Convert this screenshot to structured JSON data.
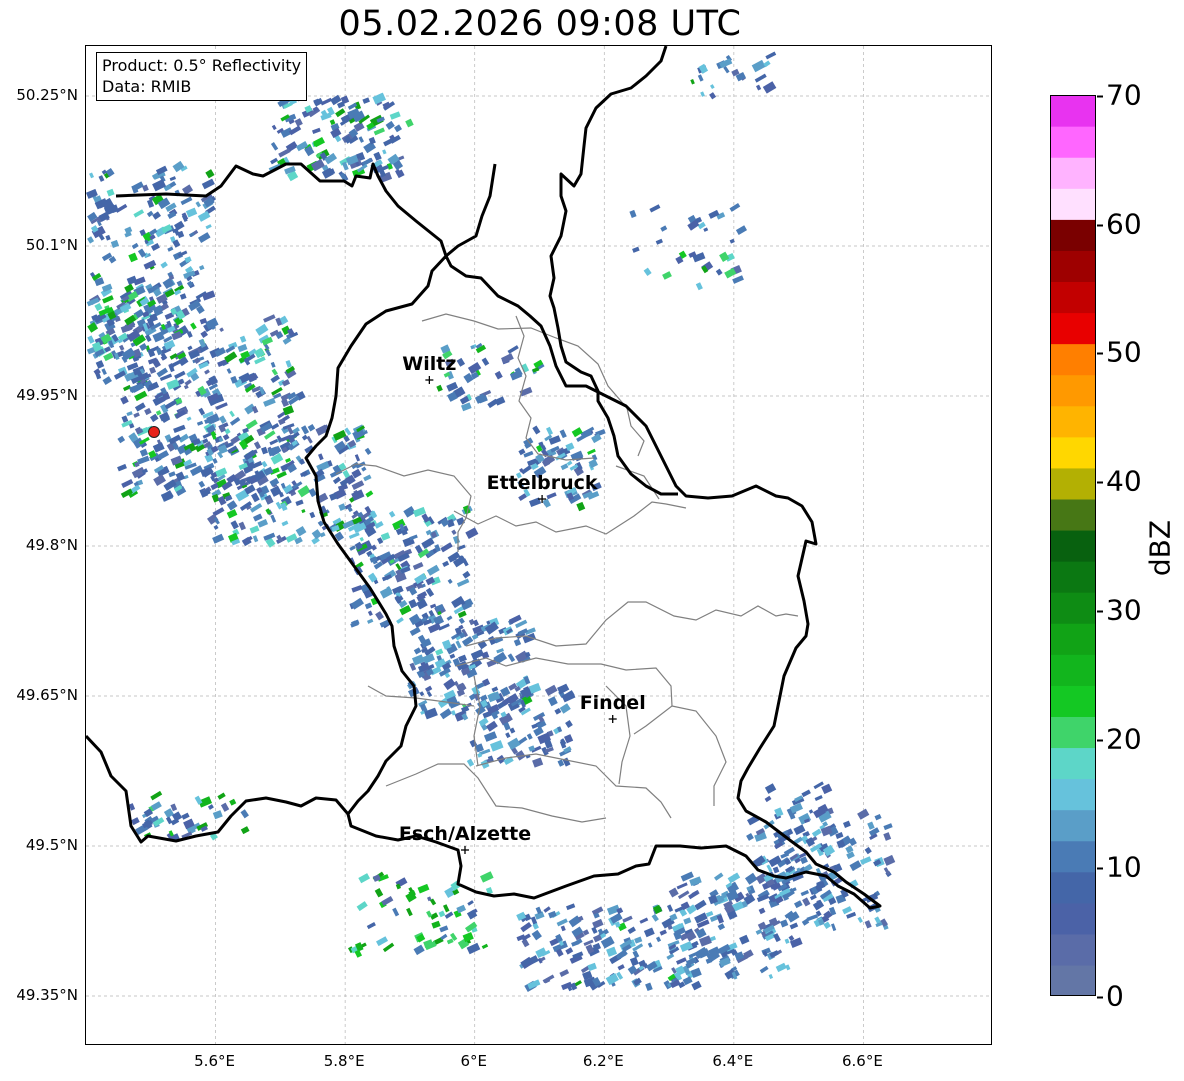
{
  "title": "05.02.2026 09:08 UTC",
  "info_box": {
    "product": "Product: 0.5° Reflectivity",
    "data": "Data: RMIB"
  },
  "map": {
    "lon_range": [
      5.4,
      6.8
    ],
    "lat_range": [
      49.3,
      50.3
    ],
    "lat_ticks": [
      {
        "value": 50.25,
        "label": "50.25°N"
      },
      {
        "value": 50.1,
        "label": "50.1°N"
      },
      {
        "value": 49.95,
        "label": "49.95°N"
      },
      {
        "value": 49.8,
        "label": "49.8°N"
      },
      {
        "value": 49.65,
        "label": "49.65°N"
      },
      {
        "value": 49.5,
        "label": "49.5°N"
      },
      {
        "value": 49.35,
        "label": "49.35°N"
      }
    ],
    "lon_ticks": [
      {
        "value": 5.6,
        "label": "5.6°E"
      },
      {
        "value": 5.8,
        "label": "5.8°E"
      },
      {
        "value": 6.0,
        "label": "6°E"
      },
      {
        "value": 6.2,
        "label": "6.2°E"
      },
      {
        "value": 6.4,
        "label": "6.4°E"
      },
      {
        "value": 6.6,
        "label": "6.6°E"
      }
    ],
    "grid": true,
    "cities": [
      {
        "name": "Wiltz",
        "lon": 5.93,
        "lat": 49.966
      },
      {
        "name": "Ettelbruck",
        "lon": 6.104,
        "lat": 49.847
      },
      {
        "name": "Findel",
        "lon": 6.213,
        "lat": 49.627
      },
      {
        "name": "Esch/Alzette",
        "lon": 5.985,
        "lat": 49.496
      }
    ],
    "radar_site": {
      "lon": 5.505,
      "lat": 49.914,
      "color": "#e8231a"
    },
    "border_color": "#000000",
    "canton_color": "#808080"
  },
  "colorbar": {
    "label": "dBZ",
    "min": 0,
    "max": 70,
    "ticks": [
      "0",
      "10",
      "20",
      "30",
      "40",
      "50",
      "60",
      "70"
    ],
    "colors": [
      "#6376a6",
      "#5a6ca8",
      "#4b62a7",
      "#4466a8",
      "#4a7bb5",
      "#5a9ec8",
      "#66c2dc",
      "#5dd6c8",
      "#3fd46a",
      "#14c823",
      "#12b51d",
      "#11a316",
      "#0e8c14",
      "#0b7812",
      "#08610f",
      "#477715",
      "#b3b003",
      "#ffd700",
      "#ffb400",
      "#ff9900",
      "#ff7f00",
      "#e80000",
      "#c20000",
      "#9e0000",
      "#7a0000",
      "#ffe0ff",
      "#ffb3ff",
      "#ff66ff",
      "#e833f0"
    ]
  }
}
